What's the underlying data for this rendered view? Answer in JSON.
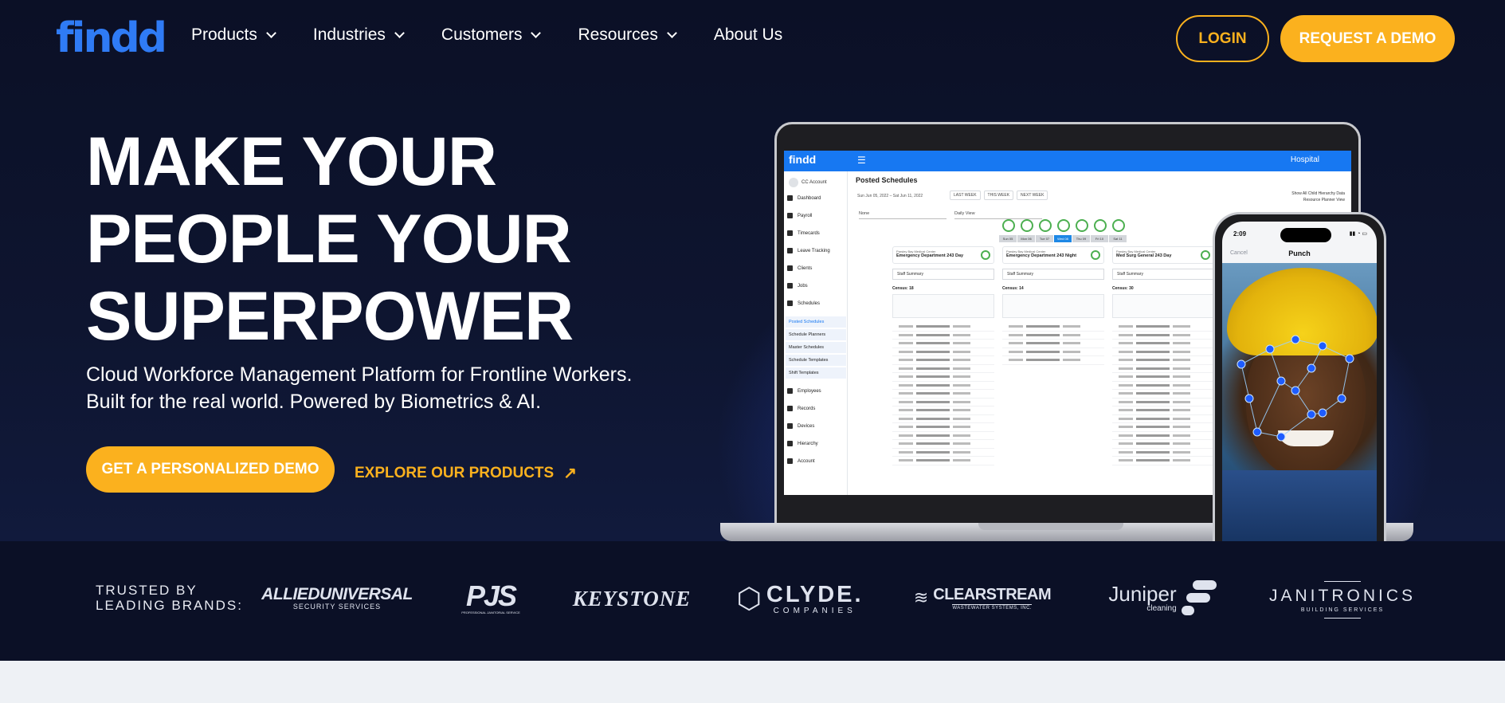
{
  "nav": {
    "logo": "findd",
    "items": [
      {
        "label": "Products",
        "has_dropdown": true
      },
      {
        "label": "Industries",
        "has_dropdown": true
      },
      {
        "label": "Customers",
        "has_dropdown": true
      },
      {
        "label": "Resources",
        "has_dropdown": true
      },
      {
        "label": "About Us",
        "has_dropdown": false
      }
    ],
    "login_label": "LOGIN",
    "demo_label": "REQUEST A DEMO"
  },
  "hero": {
    "headline": [
      "MAKE YOUR",
      "PEOPLE YOUR",
      "SUPERPOWER"
    ],
    "subtitle": [
      "Cloud Workforce Management Platform for Frontline Workers.",
      "Built for the real world. Powered by Biometrics & AI."
    ],
    "cta_primary": "GET A PERSONALIZED DEMO",
    "cta_secondary": "EXPLORE OUR PRODUCTS",
    "cta_secondary_icon": "arrow-up-right-icon"
  },
  "laptop_app": {
    "logo": "findd",
    "org": "Hospital",
    "account": "CC Account",
    "page_title": "Posted Schedules",
    "date_range": "Sun Jun 05, 2022 – Sat Jun 11, 2022",
    "week_buttons": [
      "LAST WEEK",
      "THIS WEEK",
      "NEXT WEEK"
    ],
    "toggles": [
      "Show All Child Hierarchy Data",
      "Resource Planner View"
    ],
    "filters": [
      "None",
      "Daily View"
    ],
    "sidebar": [
      "Dashboard",
      "Payroll",
      "Timecards",
      "Leave Tracking",
      "Clients",
      "Jobs",
      "Schedules"
    ],
    "sidebar_sub": [
      "Posted Schedules",
      "Schedule Planners",
      "Master Schedules",
      "Schedule Templates",
      "Shift Templates"
    ],
    "sidebar_bottom": [
      "Employees",
      "Records",
      "Devices",
      "Hierarchy",
      "Account"
    ],
    "days": [
      "Sun 05",
      "Mon 06",
      "Tue 07",
      "Wed 08",
      "Thu 09",
      "Fri 10",
      "Sat 11"
    ],
    "active_day": "Wed 08",
    "columns": [
      {
        "org": "Parsley Bay Medical Center",
        "title": "Emergency Department 243 Day",
        "staff": "Staff Summary",
        "census": "Census: 18"
      },
      {
        "org": "Parsley Bay Medical Center",
        "title": "Emergency Department 243 Night",
        "staff": "Staff Summary",
        "census": "Census: 14"
      },
      {
        "org": "Parsley Bay Medical Center",
        "title": "Med Surg General 243 Day",
        "staff": "Staff Summary",
        "census": "Census: 30"
      }
    ]
  },
  "phone_app": {
    "time": "2:09",
    "cancel": "Cancel",
    "title": "Punch"
  },
  "trusted": {
    "label": [
      "TRUSTED BY",
      "LEADING BRANDS:"
    ],
    "brands": [
      {
        "name": "ALLIEDUNIVERSAL",
        "sub": "SECURITY SERVICES"
      },
      {
        "name": "PJS",
        "sub": "PROFESSIONAL JANITORIAL SERVICE"
      },
      {
        "name": "KEYSTONE",
        "sub": ""
      },
      {
        "name": "CLYDE.",
        "sub": "COMPANIES"
      },
      {
        "name": "CLEARSTREAM",
        "sub": "WASTEWATER SYSTEMS, INC."
      },
      {
        "name": "Juniper",
        "sub": "cleaning"
      },
      {
        "name": "JANITRONICS",
        "sub": "BUILDING SERVICES"
      }
    ]
  },
  "colors": {
    "accent": "#fbb11e",
    "brand_blue": "#2f7bf5",
    "background": "#0b1026"
  }
}
